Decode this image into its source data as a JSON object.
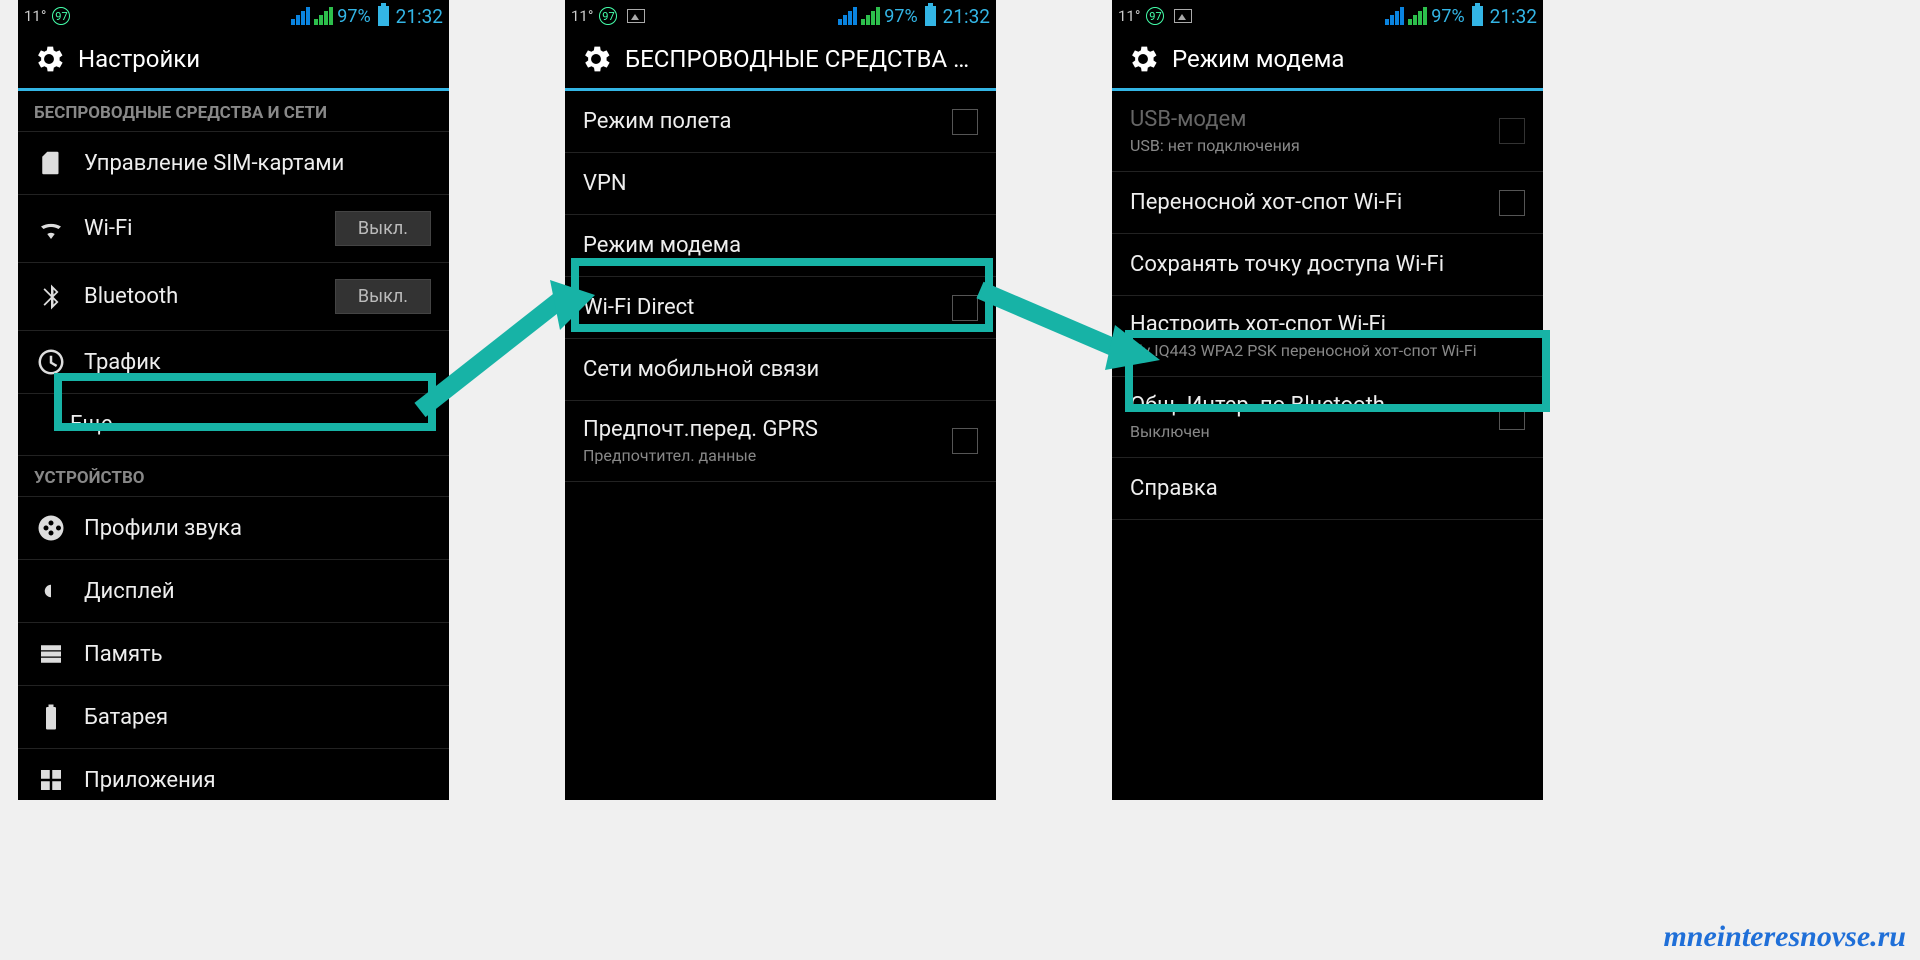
{
  "status": {
    "temp": "11°",
    "badge": "97",
    "pct": "97%",
    "time": "21:32"
  },
  "s1": {
    "title": "Настройки",
    "sec1": "БЕСПРОВОДНЫЕ СРЕДСТВА И СЕТИ",
    "sim": "Управление SIM-картами",
    "wifi": "Wi-Fi",
    "wifi_state": "Выкл.",
    "bt": "Bluetooth",
    "bt_state": "Выкл.",
    "traffic": "Трафик",
    "more": "Еще…",
    "sec2": "УСТРОЙСТВО",
    "sound": "Профили звука",
    "display": "Дисплей",
    "memory": "Память",
    "battery": "Батарея",
    "apps": "Приложения"
  },
  "s2": {
    "title": "БЕСПРОВОДНЫЕ СРЕДСТВА И СЕ…",
    "airplane": "Режим полета",
    "vpn": "VPN",
    "tether": "Режим модема",
    "wifidirect": "Wi-Fi Direct",
    "mobile": "Сети мобильной связи",
    "gprs": "Предпочт.перед. GPRS",
    "gprs_sub": "Предпочтител. данные"
  },
  "s3": {
    "title": "Режим модема",
    "usb": "USB-модем",
    "usb_sub": "USB: нет подключения",
    "hotspot": "Переносной хот-спот Wi-Fi",
    "save": "Сохранять точку доступа Wi-Fi",
    "setup": "Настроить хот-спот Wi-Fi",
    "setup_sub": "Fly IQ443 WPA2 PSK переносной хот-спот Wi-Fi",
    "btshare": "Общ. Интер. по Bluetooth",
    "btshare_sub": "Выключен",
    "help": "Справка"
  },
  "watermark": "mneinteresnovse.ru"
}
